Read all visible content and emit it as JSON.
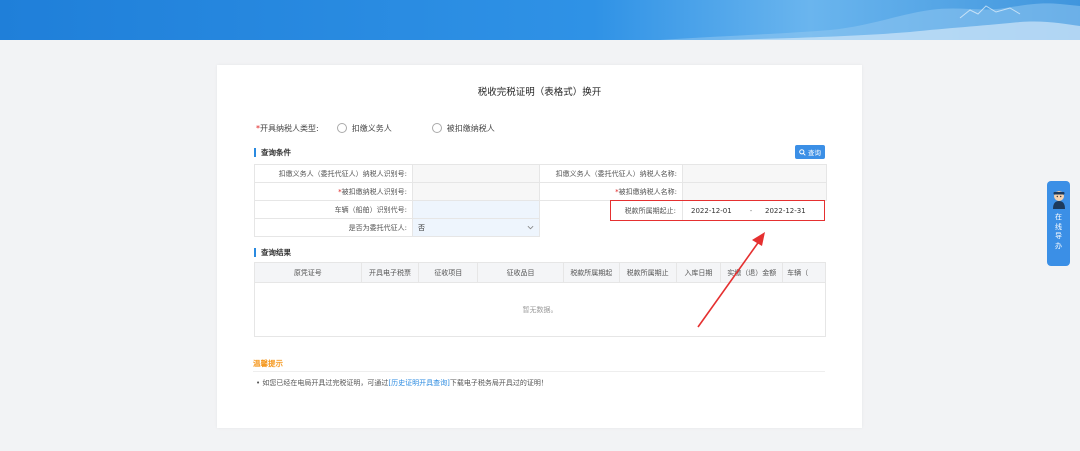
{
  "page": {
    "title": "税收完税证明（表格式）换开"
  },
  "taxpayer_type": {
    "required_mark": "*",
    "label": "开具纳税人类型:",
    "options": [
      "扣缴义务人",
      "被扣缴纳税人"
    ]
  },
  "query": {
    "section_title": "查询条件",
    "button_label": "查询",
    "rows": [
      {
        "label1": "扣缴义务人（委托代征人）纳税人识别号:",
        "value1": "",
        "label2": "扣缴义务人（委托代征人）纳税人名称:",
        "value2": ""
      },
      {
        "req1": "*",
        "label1": "被扣缴纳税人识别号:",
        "value1": "",
        "req2": "*",
        "label2": "被扣缴纳税人名称:",
        "value2": ""
      },
      {
        "label1": "车辆（船舶）识别代号:",
        "value1": ""
      },
      {
        "label1": "是否为委托代征人:",
        "value1": "否"
      }
    ],
    "period": {
      "label": "税款所属期起止:",
      "start": "2022-12-01",
      "separator": "-",
      "end": "2022-12-31"
    }
  },
  "results": {
    "section_title": "查询结果",
    "columns": [
      "原凭证号",
      "开具电子税票",
      "征收项目",
      "征收品目",
      "税款所属期起",
      "税款所属期止",
      "入库日期",
      "实缴（退）金额",
      "车辆（"
    ],
    "empty_text": "暂无数据。"
  },
  "tips": {
    "title": "温馨提示",
    "bullet": "•",
    "text_before": "如您已经在电局开具过完税证明，可通过",
    "link_text": "[历史证明开具查询]",
    "text_after": "下载电子税务局开具过的证明！"
  },
  "side_widget": {
    "chars": [
      "在",
      "线",
      "导",
      "办"
    ]
  },
  "colors": {
    "accent": "#3b8fe6",
    "highlight_border": "#e53030",
    "tips_title": "#f59a23",
    "required": "#e02020"
  },
  "icons": [
    "search-icon",
    "assistant-avatar-icon",
    "chevron-down-icon",
    "annotation-arrow-icon"
  ]
}
